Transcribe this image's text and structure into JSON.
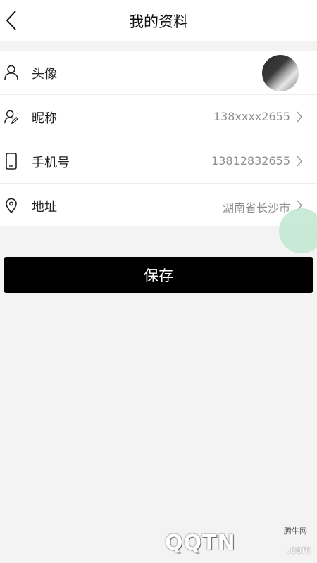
{
  "header": {
    "title": "我的资料",
    "back_icon": "back-chevron-icon"
  },
  "rows": [
    {
      "label": "头像",
      "icon": "user-icon"
    },
    {
      "label": "昵称",
      "value": "138xxxx2655",
      "icon": "user-edit-icon"
    },
    {
      "label": "手机号",
      "value": "13812832655",
      "icon": "phone-icon"
    },
    {
      "label": "地址",
      "value": "湖南省长沙市",
      "icon": "location-pin-icon"
    }
  ],
  "save_button": {
    "label": "保存"
  },
  "watermark": {
    "site": "腾牛网",
    "logo": "QQTN",
    "suffix": ".com"
  },
  "colors": {
    "background": "#f3f3f3",
    "button": "#000000",
    "value_text": "#8f8f8f",
    "floating_button": "#bfe6d0"
  }
}
